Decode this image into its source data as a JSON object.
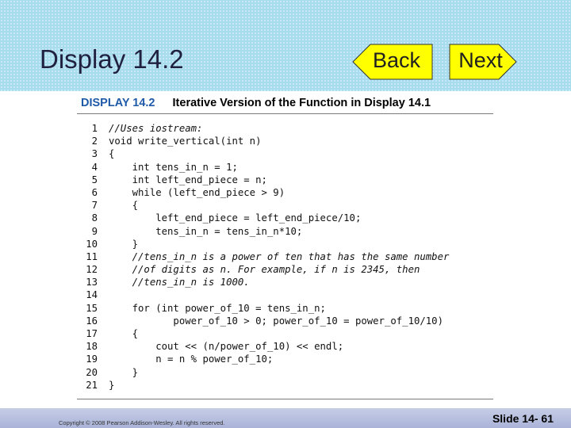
{
  "slide": {
    "title": "Display 14.2",
    "back_label": "Back",
    "next_label": "Next"
  },
  "display": {
    "number": "DISPLAY 14.2",
    "caption": "Iterative Version of the Function in Display 14.1"
  },
  "code_lines": [
    {
      "n": "1",
      "t": "//Uses iostream:",
      "c": true
    },
    {
      "n": "2",
      "t": "void write_vertical(int n)"
    },
    {
      "n": "3",
      "t": "{"
    },
    {
      "n": "4",
      "t": "    int tens_in_n = 1;"
    },
    {
      "n": "5",
      "t": "    int left_end_piece = n;"
    },
    {
      "n": "6",
      "t": "    while (left_end_piece > 9)"
    },
    {
      "n": "7",
      "t": "    {"
    },
    {
      "n": "8",
      "t": "        left_end_piece = left_end_piece/10;"
    },
    {
      "n": "9",
      "t": "        tens_in_n = tens_in_n*10;"
    },
    {
      "n": "10",
      "t": "    }"
    },
    {
      "n": "11",
      "t": "    //tens_in_n is a power of ten that has the same number",
      "c": true
    },
    {
      "n": "12",
      "t": "    //of digits as n. For example, if n is 2345, then",
      "c": true
    },
    {
      "n": "13",
      "t": "    //tens_in_n is 1000.",
      "c": true
    },
    {
      "n": "14",
      "t": ""
    },
    {
      "n": "15",
      "t": "    for (int power_of_10 = tens_in_n;"
    },
    {
      "n": "16",
      "t": "           power_of_10 > 0; power_of_10 = power_of_10/10)"
    },
    {
      "n": "17",
      "t": "    {"
    },
    {
      "n": "18",
      "t": "        cout << (n/power_of_10) << endl;"
    },
    {
      "n": "19",
      "t": "        n = n % power_of_10;"
    },
    {
      "n": "20",
      "t": "    }"
    },
    {
      "n": "21",
      "t": "}"
    }
  ],
  "footer": {
    "copyright": "Copyright © 2008 Pearson Addison-Wesley. All rights reserved.",
    "slide_number": "Slide 14- 61"
  },
  "colors": {
    "header_bg": "#a8dcee",
    "display_label": "#1f5aa8",
    "footer_bg": "#b4bde0"
  }
}
